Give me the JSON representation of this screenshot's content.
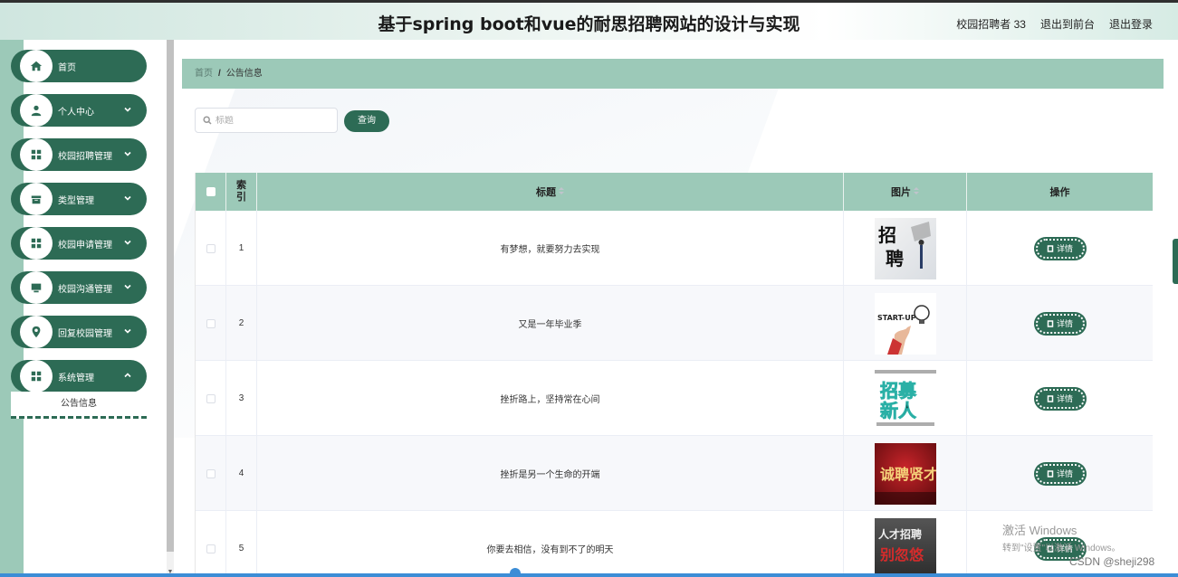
{
  "header": {
    "title": "基于spring boot和vue的耐思招聘网站的设计与实现",
    "user": "校园招聘者 33",
    "front": "退出到前台",
    "logout": "退出登录"
  },
  "sidebar": {
    "items": [
      {
        "label": "首页",
        "icon": "home-icon"
      },
      {
        "label": "个人中心",
        "icon": "user-icon"
      },
      {
        "label": "校园招聘管理",
        "icon": "grid-icon"
      },
      {
        "label": "类型管理",
        "icon": "box-icon"
      },
      {
        "label": "校园申请管理",
        "icon": "grid-icon"
      },
      {
        "label": "校园沟通管理",
        "icon": "monitor-icon"
      },
      {
        "label": "回复校园管理",
        "icon": "location-icon"
      },
      {
        "label": "系统管理",
        "icon": "grid-icon"
      }
    ],
    "sub_item": "公告信息"
  },
  "breadcrumb": {
    "home": "首页",
    "sep": "/",
    "current": "公告信息"
  },
  "search": {
    "placeholder": "标题",
    "button": "查询"
  },
  "table": {
    "headers": {
      "index": "索\n引",
      "title": "标题",
      "image": "图片",
      "action": "操作"
    },
    "rows": [
      {
        "index": "1",
        "title": "有梦想，就要努力去实现",
        "image": "recruit-poster-1"
      },
      {
        "index": "2",
        "title": "又是一年毕业季",
        "image": "startup-poster"
      },
      {
        "index": "3",
        "title": "挫折路上，坚持常在心间",
        "image": "recruit-poster-3"
      },
      {
        "index": "4",
        "title": "挫折是另一个生命的开端",
        "image": "recruit-poster-4"
      },
      {
        "index": "5",
        "title": "你要去相信，没有到不了的明天",
        "image": "recruit-poster-5"
      }
    ],
    "detail_label": "详情"
  },
  "watermark": {
    "line1": "激活 Windows",
    "line2": "转到\"设置\"以激活 Windows。"
  },
  "csdn": "CSDN @sheji298",
  "colors": {
    "primary": "#2d6b55",
    "accent": "#9cc9b8"
  }
}
